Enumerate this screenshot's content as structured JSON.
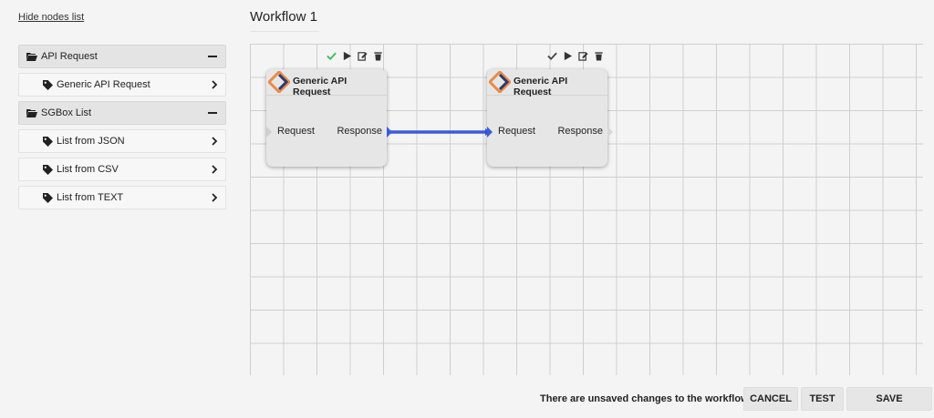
{
  "sidebar": {
    "hide_link": "Hide nodes list",
    "groups": [
      {
        "label": "API Request",
        "items": [
          {
            "label": "Generic API Request"
          }
        ]
      },
      {
        "label": "SGBox List",
        "items": [
          {
            "label": "List from JSON"
          },
          {
            "label": "List from CSV"
          },
          {
            "label": "List from TEXT"
          }
        ]
      }
    ]
  },
  "workflow": {
    "title": "Workflow 1",
    "nodes": [
      {
        "title": "Generic API Request",
        "input_label": "Request",
        "output_label": "Response",
        "status_icon": "check-icon",
        "status_color": "#3dba4e"
      },
      {
        "title": "Generic API Request",
        "input_label": "Request",
        "output_label": "Response",
        "status_icon": "check-icon",
        "status_color": "#444444"
      }
    ],
    "connection_color": "#3b5bdb"
  },
  "footer": {
    "status": "There are unsaved changes to the workflow",
    "cancel_label": "CANCEL",
    "test_label": "TEST",
    "save_label": "SAVE"
  }
}
